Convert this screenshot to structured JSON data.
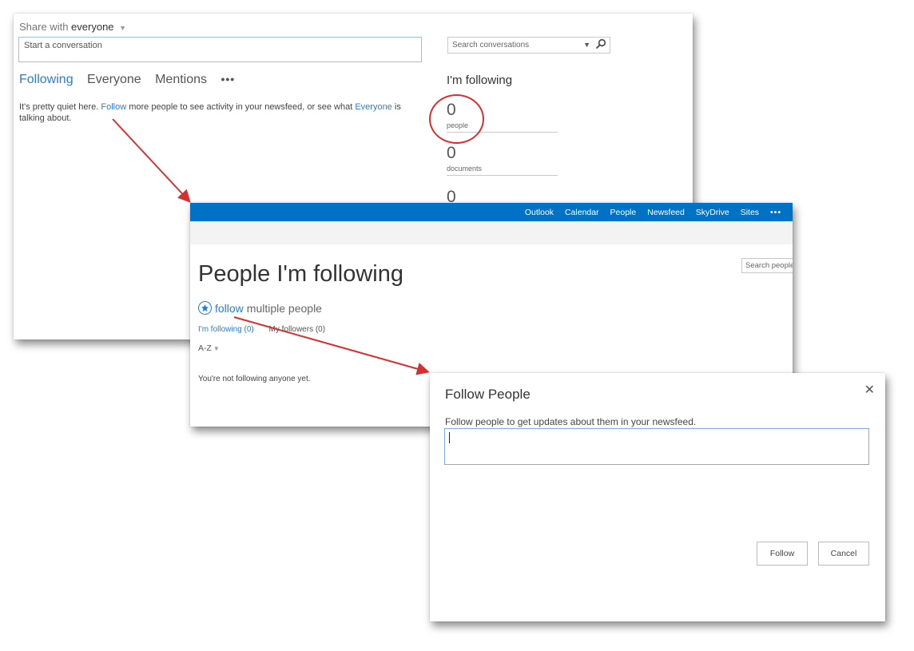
{
  "newsfeed": {
    "share_prefix": "Share with",
    "share_target": "everyone",
    "post_placeholder": "Start a conversation",
    "tabs": [
      {
        "label": "Following"
      },
      {
        "label": "Everyone"
      },
      {
        "label": "Mentions"
      },
      {
        "label": "•••"
      }
    ],
    "quiet_message": {
      "part1": "It's pretty quiet here. ",
      "follow_link": "Follow",
      "part2": " more people to see activity in your newsfeed, or see what ",
      "everyone_link": "Everyone",
      "part3": " is talking about."
    },
    "search_placeholder": "Search conversations",
    "following_heading": "I'm following",
    "stats": [
      {
        "count": "0",
        "label": "people"
      },
      {
        "count": "0",
        "label": "documents"
      },
      {
        "count": "0"
      }
    ]
  },
  "people_page": {
    "nav": [
      "Outlook",
      "Calendar",
      "People",
      "Newsfeed",
      "SkyDrive",
      "Sites",
      "•••"
    ],
    "search_placeholder": "Search people",
    "title": "People I'm following",
    "follow_link": "follow",
    "follow_suffix": "multiple people",
    "tabs": [
      {
        "label": "I'm following (0)"
      },
      {
        "label": "My followers (0)"
      }
    ],
    "sort_label": "A-Z",
    "empty_message": "You're not following anyone yet."
  },
  "dialog": {
    "title": "Follow People",
    "close_glyph": "✕",
    "description": "Follow people to get updates about them in your newsfeed.",
    "follow_button": "Follow",
    "cancel_button": "Cancel"
  },
  "colors": {
    "accent": "#0072c6",
    "link": "#2a7bd2",
    "annotation": "#d72e2e"
  }
}
